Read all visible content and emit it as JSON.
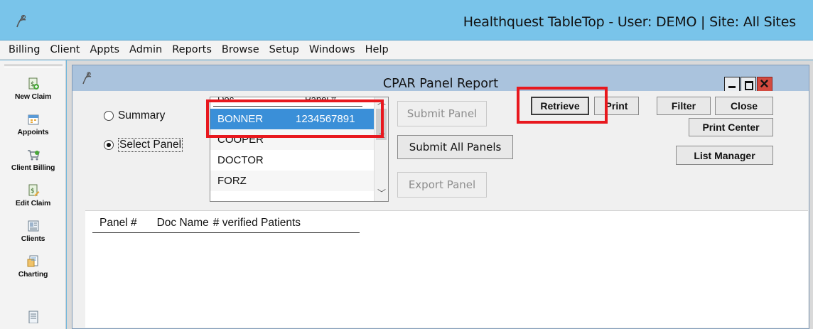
{
  "app": {
    "title": "Healthquest TableTop - User: DEMO | Site: All Sites"
  },
  "menu": [
    "Billing",
    "Client",
    "Appts",
    "Admin",
    "Reports",
    "Browse",
    "Setup",
    "Windows",
    "Help"
  ],
  "toolbar": [
    {
      "label": "New Claim",
      "icon": "new-claim-icon"
    },
    {
      "label": "Appoints",
      "icon": "calendar-icon"
    },
    {
      "label": "Client Billing",
      "icon": "cart-icon"
    },
    {
      "label": "Edit Claim",
      "icon": "edit-claim-icon"
    },
    {
      "label": "Clients",
      "icon": "clients-icon"
    },
    {
      "label": "Charting",
      "icon": "charting-icon"
    },
    {
      "label": "",
      "icon": "notes-icon"
    }
  ],
  "window": {
    "title": "CPAR Panel Report"
  },
  "options": {
    "summary": "Summary",
    "select_panel": "Select Panel",
    "selected": "select_panel"
  },
  "doc_list": {
    "headers": [
      "Doc",
      "Panel #"
    ],
    "rows": [
      {
        "doc": "BONNER",
        "panel": "1234567891",
        "selected": true
      },
      {
        "doc": "COOPER",
        "panel": ""
      },
      {
        "doc": "DOCTOR",
        "panel": ""
      },
      {
        "doc": "FORZ",
        "panel": ""
      }
    ]
  },
  "actions": {
    "submit_panel": "Submit Panel",
    "submit_all": "Submit All Panels",
    "export_panel": "Export Panel"
  },
  "buttons": {
    "retrieve": "Retrieve",
    "print": "Print",
    "filter": "Filter",
    "close": "Close",
    "print_center": "Print Center",
    "list_manager": "List Manager"
  },
  "grid": {
    "columns": [
      "Panel #",
      "Doc Name",
      "# verified Patients"
    ]
  },
  "colors": {
    "titlebar": "#79c4ea",
    "selection": "#3a8fd8",
    "annotation": "#e8181e",
    "close_button": "#d24a3f"
  }
}
